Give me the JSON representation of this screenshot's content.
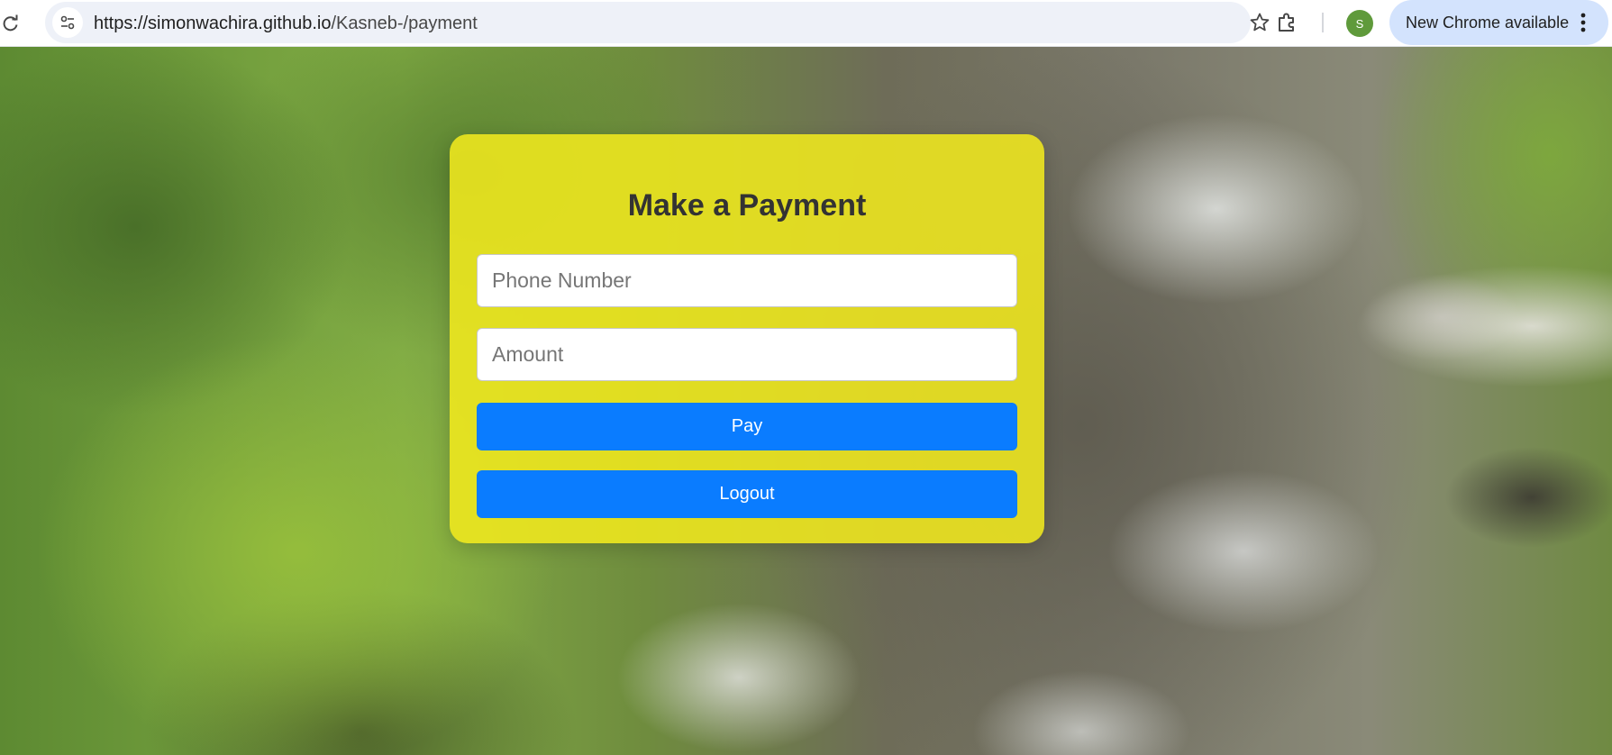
{
  "browser": {
    "url_host": "https://simonwachira.github.io",
    "url_path": "/Kasneb-/payment",
    "profile_initial": "S",
    "update_label": "New Chrome available",
    "icons": {
      "reload": "reload-icon",
      "site_info": "site-info-icon",
      "bookmark": "star-icon",
      "extensions": "puzzle-icon",
      "menu": "kebab-menu-icon"
    },
    "colors": {
      "omnibox": "#eef1f8",
      "avatar": "#5f9a3b",
      "update_chip": "#d3e3fd"
    }
  },
  "page": {
    "title": "Make a Payment",
    "phone_placeholder": "Phone Number",
    "phone_value": "",
    "amount_placeholder": "Amount",
    "amount_value": "",
    "pay_label": "Pay",
    "logout_label": "Logout",
    "colors": {
      "card": "#f0e81e",
      "button": "#0a7cff",
      "title": "#333333"
    }
  }
}
